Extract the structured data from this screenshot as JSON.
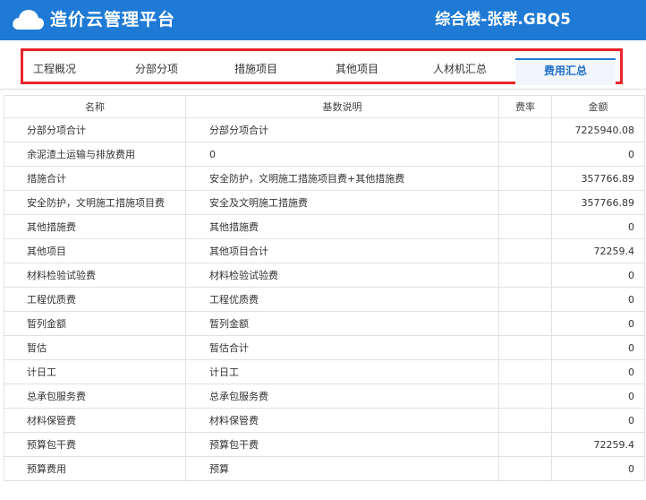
{
  "header": {
    "logo_icon": "cloud-icon",
    "app_title": "造价云管理平台",
    "project_name": "综合楼-张群.GBQ5",
    "background_color": "#1f7ad6"
  },
  "tabs": [
    {
      "label": "工程概况",
      "active": false
    },
    {
      "label": "分部分项",
      "active": false
    },
    {
      "label": "措施项目",
      "active": false
    },
    {
      "label": "其他项目",
      "active": false
    },
    {
      "label": "人材机汇总",
      "active": false
    },
    {
      "label": "费用汇总",
      "active": true
    }
  ],
  "highlight_color": "#e8242a",
  "table": {
    "columns": [
      "名称",
      "基数说明",
      "费率",
      "金额"
    ],
    "rows": [
      {
        "name": "分部分项合计",
        "basis": "分部分项合计",
        "rate": "",
        "amount": "7225940.08"
      },
      {
        "name": "余泥渣土运输与排放费用",
        "basis": "0",
        "rate": "",
        "amount": "0"
      },
      {
        "name": "措施合计",
        "basis": "安全防护，文明施工措施项目费+其他措施费",
        "rate": "",
        "amount": "357766.89"
      },
      {
        "name": "安全防护，文明施工措施项目费",
        "basis": "安全及文明施工措施费",
        "rate": "",
        "amount": "357766.89"
      },
      {
        "name": "其他措施费",
        "basis": "其他措施费",
        "rate": "",
        "amount": "0"
      },
      {
        "name": "其他项目",
        "basis": "其他项目合计",
        "rate": "",
        "amount": "72259.4"
      },
      {
        "name": "材料检验试验费",
        "basis": "材料检验试验费",
        "rate": "",
        "amount": "0"
      },
      {
        "name": "工程优质费",
        "basis": "工程优质费",
        "rate": "",
        "amount": "0"
      },
      {
        "name": "暂列金额",
        "basis": "暂列金额",
        "rate": "",
        "amount": "0"
      },
      {
        "name": "暂估",
        "basis": "暂估合计",
        "rate": "",
        "amount": "0"
      },
      {
        "name": "计日工",
        "basis": "计日工",
        "rate": "",
        "amount": "0"
      },
      {
        "name": "总承包服务费",
        "basis": "总承包服务费",
        "rate": "",
        "amount": "0"
      },
      {
        "name": "材料保管费",
        "basis": "材料保管费",
        "rate": "",
        "amount": "0"
      },
      {
        "name": "预算包干费",
        "basis": "预算包干费",
        "rate": "",
        "amount": "72259.4"
      },
      {
        "name": "预算费用",
        "basis": "预算",
        "rate": "",
        "amount": "0"
      }
    ]
  }
}
